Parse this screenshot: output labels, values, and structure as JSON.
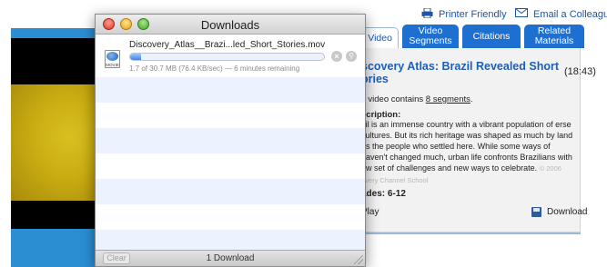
{
  "top_links": {
    "printer_friendly": "Printer Friendly",
    "email_colleague": "Email a Colleague"
  },
  "tabs": {
    "full_video": "l Video",
    "video_segments_line1": "Video",
    "video_segments_line2": "Segments",
    "citations": "Citations",
    "related_line1": "Related",
    "related_line2": "Materials"
  },
  "info": {
    "title": "scovery Atlas: Brazil Revealed Short ories",
    "title_line1": "scovery Atlas: Brazil Revealed Short",
    "title_line2": "ories",
    "duration": "(18:43)",
    "segments_prefix": "s video contains ",
    "segments_link": "8 segments",
    "segments_suffix": ".",
    "description_label": "scription:",
    "description_text": "zil is an immense country with a vibrant population of erse cultures. But its rich heritage was shaped as much by land as the people who settled here. While some ways of haven't changed much, urban life confronts Brazilians with ew set of challenges and new ways to celebrate.",
    "description_copyright": "© 2006 overy Channel School",
    "grades": "ades: 6-12",
    "play": "Play",
    "download": "Download"
  },
  "downloads_window": {
    "title": "Downloads",
    "items": [
      {
        "filename": "Discovery_Atlas__Brazi...led_Short_Stories.mov",
        "status": "1.7 of 30.7 MB (76.4 KB/sec) — 6 minutes remaining",
        "progress": 0.055,
        "icon_caption": "MOVIE"
      }
    ],
    "clear_label": "Clear",
    "count_label": "1 Download"
  },
  "colors": {
    "accent_blue": "#1d6fd0",
    "link_blue": "#1a55a8",
    "video_panel_blue": "#2b8ed3",
    "list_stripe": "#edf3fe"
  }
}
